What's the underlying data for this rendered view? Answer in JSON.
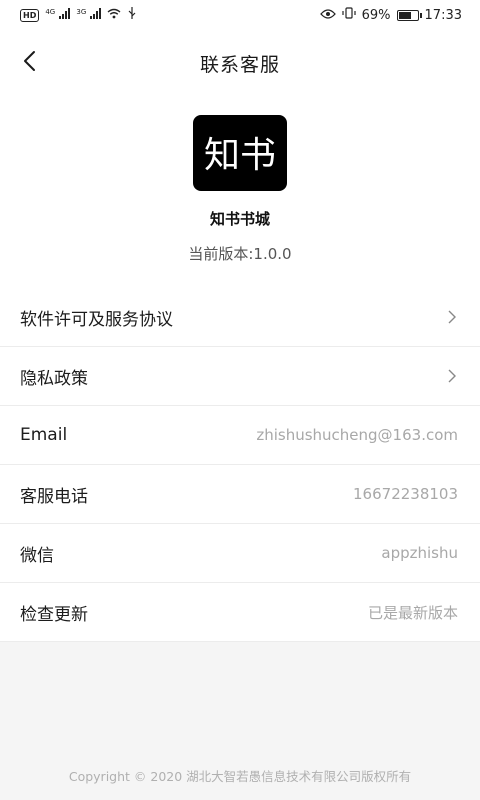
{
  "status_bar": {
    "hd_badge": "HD",
    "signal1_label": "4G",
    "signal2_label": "3G",
    "battery_percent": "69%",
    "battery_level": 0.69,
    "time": "17:33"
  },
  "header": {
    "title": "联系客服"
  },
  "app": {
    "logo_text": "知书",
    "name": "知书书城",
    "version": "当前版本:1.0.0"
  },
  "rows": [
    {
      "label": "软件许可及服务协议",
      "value": "",
      "chevron": true
    },
    {
      "label": "隐私政策",
      "value": "",
      "chevron": true
    },
    {
      "label": "Email",
      "value": "zhishushucheng@163.com",
      "chevron": false
    },
    {
      "label": "客服电话",
      "value": "16672238103",
      "chevron": false
    },
    {
      "label": "微信",
      "value": "appzhishu",
      "chevron": false
    },
    {
      "label": "检查更新",
      "value": "已是最新版本",
      "chevron": false
    }
  ],
  "footer": {
    "copyright": "Copyright © 2020 湖北大智若愚信息技术有限公司版权所有"
  },
  "colors": {
    "logo_bg": "#000000",
    "footer_bg": "#f5f5f5"
  }
}
